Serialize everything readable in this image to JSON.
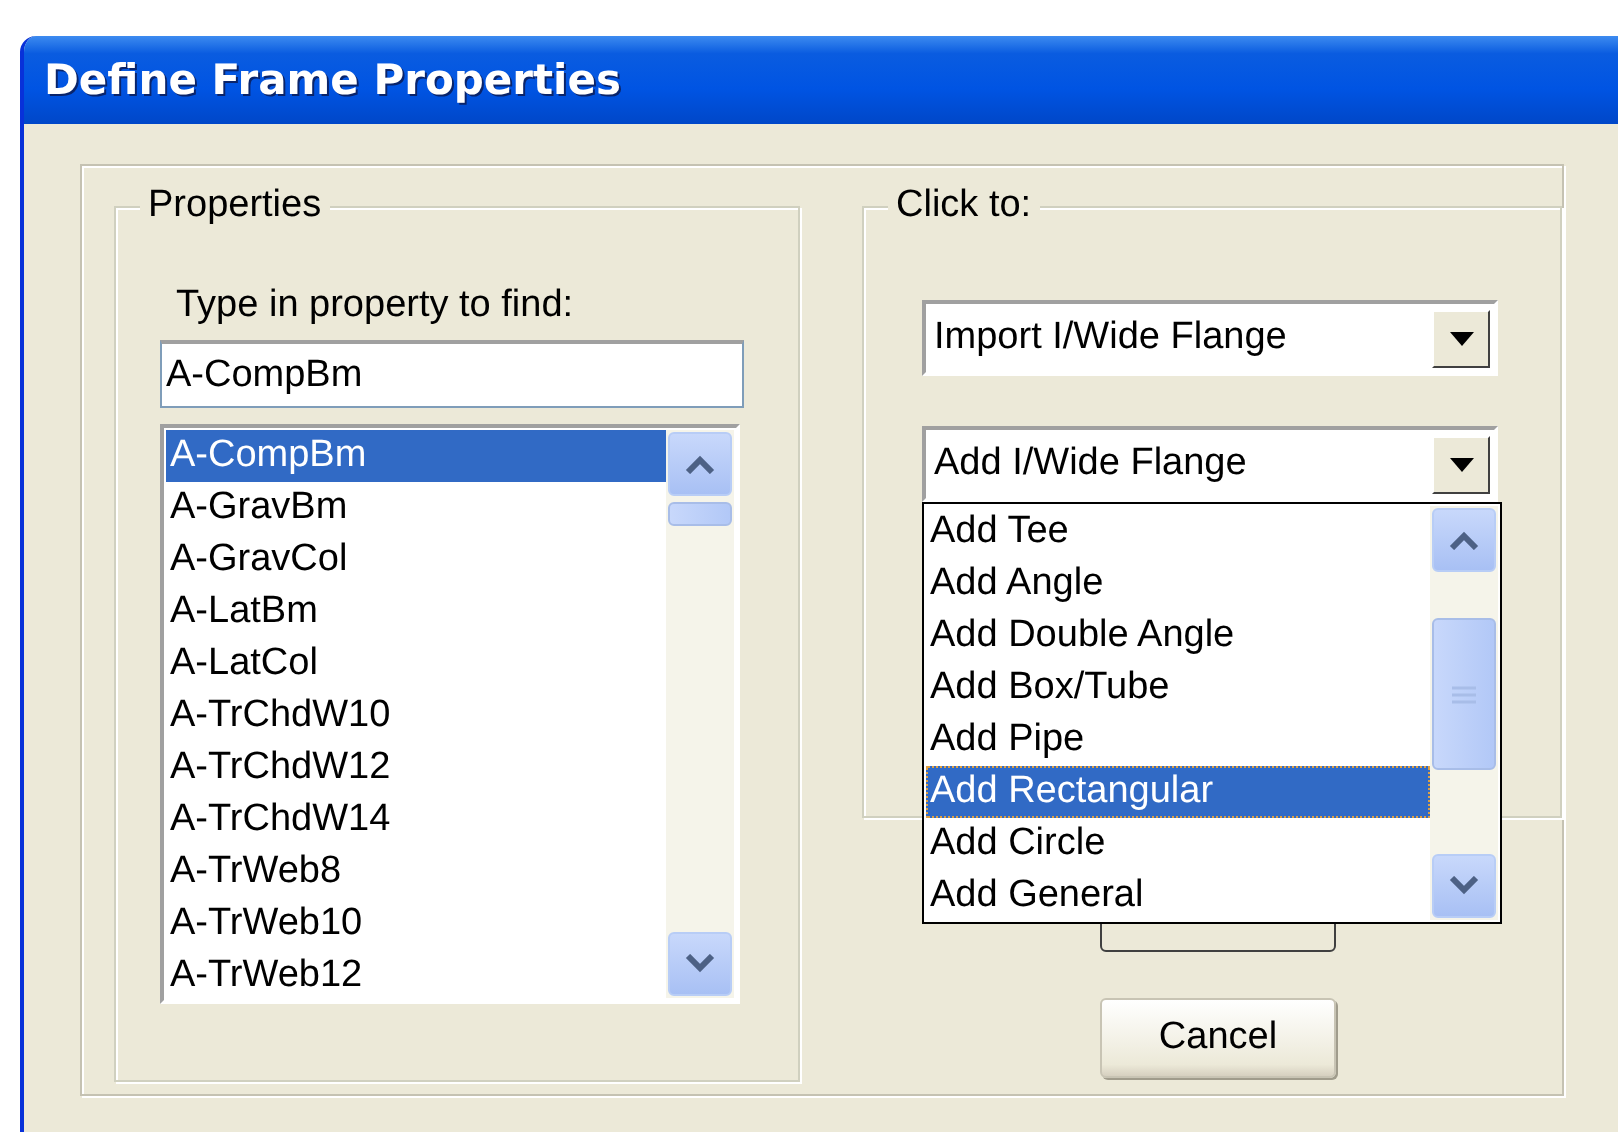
{
  "window": {
    "title": "Define Frame Properties"
  },
  "properties": {
    "legend": "Properties",
    "search_label": "Type in property to find:",
    "search_value": "A-CompBm",
    "items": [
      {
        "label": "A-CompBm",
        "selected": true
      },
      {
        "label": "A-GravBm",
        "selected": false
      },
      {
        "label": "A-GravCol",
        "selected": false
      },
      {
        "label": "A-LatBm",
        "selected": false
      },
      {
        "label": "A-LatCol",
        "selected": false
      },
      {
        "label": "A-TrChdW10",
        "selected": false
      },
      {
        "label": "A-TrChdW12",
        "selected": false
      },
      {
        "label": "A-TrChdW14",
        "selected": false
      },
      {
        "label": "A-TrWeb8",
        "selected": false
      },
      {
        "label": "A-TrWeb10",
        "selected": false
      },
      {
        "label": "A-TrWeb12",
        "selected": false
      }
    ]
  },
  "click_to": {
    "legend": "Click to:",
    "import_select": {
      "value": "Import I/Wide Flange"
    },
    "add_select": {
      "value": "Add I/Wide Flange",
      "expanded": true,
      "options": [
        {
          "label": "Add Tee",
          "selected": false
        },
        {
          "label": "Add Angle",
          "selected": false
        },
        {
          "label": "Add Double Angle",
          "selected": false
        },
        {
          "label": "Add Box/Tube",
          "selected": false
        },
        {
          "label": "Add Pipe",
          "selected": false
        },
        {
          "label": "Add Rectangular",
          "selected": true
        },
        {
          "label": "Add Circle",
          "selected": false
        },
        {
          "label": "Add General",
          "selected": false
        }
      ]
    }
  },
  "buttons": [
    {
      "label": "Cancel"
    }
  ]
}
